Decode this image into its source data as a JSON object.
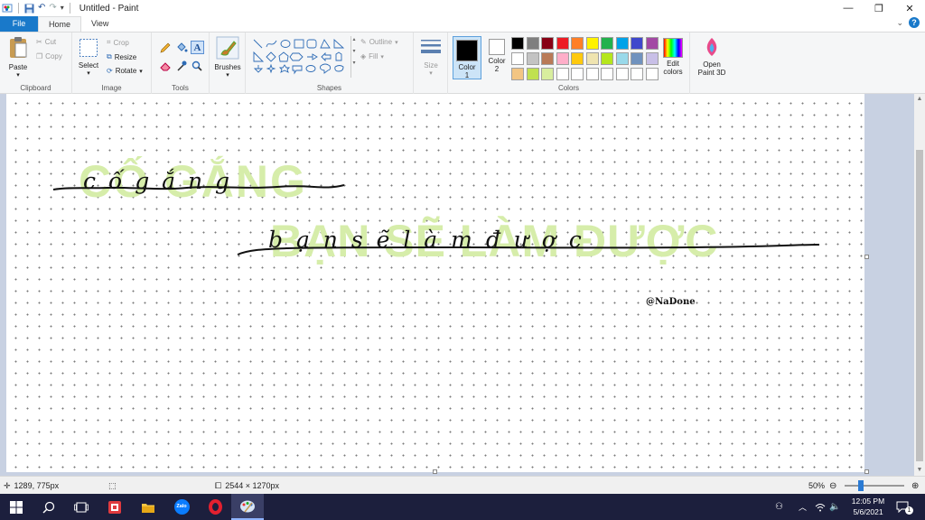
{
  "window": {
    "title": "Untitled - Paint",
    "minimize": "—",
    "maximize": "❐",
    "close": "✕"
  },
  "tabs": {
    "file": "File",
    "home": "Home",
    "view": "View"
  },
  "ribbon": {
    "clipboard": {
      "paste": "Paste",
      "cut": "Cut",
      "copy": "Copy",
      "label": "Clipboard"
    },
    "image": {
      "select": "Select",
      "crop": "Crop",
      "resize": "Resize",
      "rotate": "Rotate",
      "label": "Image"
    },
    "tools": {
      "label": "Tools"
    },
    "brushes": {
      "label": "Brushes"
    },
    "shapes": {
      "outline": "Outline",
      "fill": "Fill",
      "label": "Shapes"
    },
    "size": {
      "label": "Size"
    },
    "color1": {
      "label": "Color",
      "num": "1",
      "value": "#000000"
    },
    "color2": {
      "label": "Color",
      "num": "2",
      "value": "#ffffff"
    },
    "colors": {
      "label": "Colors"
    },
    "edit_colors": {
      "line1": "Edit",
      "line2": "colors"
    },
    "paint3d": {
      "line1": "Open",
      "line2": "Paint 3D"
    }
  },
  "palette": [
    "#000000",
    "#7f7f7f",
    "#880015",
    "#ed1c24",
    "#ff7f27",
    "#fff200",
    "#22b14c",
    "#00a2e8",
    "#3f48cc",
    "#a349a4",
    "#ffffff",
    "#c3c3c3",
    "#b97a57",
    "#ffaec9",
    "#ffc90e",
    "#efe4b0",
    "#b5e61d",
    "#99d9ea",
    "#7092be",
    "#c8bfe7",
    "#f2c583",
    "#c0e14f",
    "#d8ee9e",
    "#ffffff",
    "#ffffff",
    "#ffffff",
    "#ffffff",
    "#ffffff",
    "#ffffff",
    "#ffffff"
  ],
  "canvas": {
    "line1_bg": "CỐ GẮNG",
    "line1_script": "c ố g ắ n g",
    "line2_bg": "BẠN SẼ LÀM ĐƯỢC",
    "line2_script": "b ạ n s ẽ l à m đ ư ợ c",
    "signature": "@NaDone",
    "highlight_color": "#d6edaa"
  },
  "status": {
    "cursor_pos": "1289, 775px",
    "image_size": "2544 × 1270px",
    "zoom": "50%"
  },
  "taskbar": {
    "time": "12:05 PM",
    "date": "5/6/2021",
    "notifications": "1"
  }
}
